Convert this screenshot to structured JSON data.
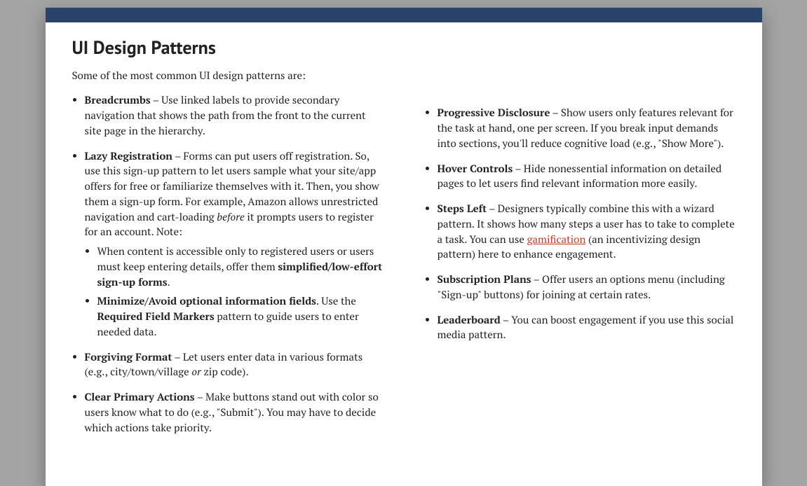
{
  "title": "UI Design Patterns",
  "intro": "Some of the most common UI design patterns are:",
  "col1": {
    "breadcrumbs": {
      "name": "Breadcrumbs",
      "desc": " – Use linked labels to provide secondary navigation that shows the path from the front to the current site page in the hierarchy."
    },
    "lazy": {
      "name": "Lazy Registration",
      "pre": " – Forms can put users off registration. So, use this sign-up pattern to let users sample what your site/app offers for free or familiarize themselves with it. Then, you show them a sign-up form. For example, Amazon allows unrestricted navigation and cart-loading ",
      "beforeWord": "before",
      "post": " it prompts users to register for an account. Note:",
      "sub1a": "When content is accessible only to registered users or users must keep entering details, offer them ",
      "sub1b": "simplified/low-effort sign-up forms",
      "sub1c": ".",
      "sub2a": "Minimize/Avoid optional information fields",
      "sub2b": ". Use the ",
      "sub2c": "Required Field Markers",
      "sub2d": " pattern to guide users to enter needed data."
    },
    "forgiving": {
      "name": "Forgiving Format",
      "pre": " – Let users enter data in various formats (e.g., city/town/village ",
      "orWord": "or",
      "post": " zip code)."
    },
    "clear": {
      "name": "Clear Primary Actions",
      "desc": " – Make buttons stand out with color so users know what to do (e.g., \"Submit\"). You may have to decide which actions take priority."
    }
  },
  "col2": {
    "progressive": {
      "name": "Progressive Disclosure",
      "desc": " – Show users only features relevant for the task at hand, one per screen. If you break input demands into sections, you'll reduce cognitive load (e.g., \"Show More\")."
    },
    "hover": {
      "name": "Hover Controls",
      "desc": " – Hide nonessential information on detailed pages to let users find relevant information more easily."
    },
    "steps": {
      "name": "Steps Left",
      "pre": " – Designers typically combine this with a wizard pattern. It shows how many steps a user has to take to complete a task. You can use ",
      "link": "gamification",
      "post": " (an incentivizing design pattern) here to enhance engagement."
    },
    "subscription": {
      "name": "Subscription Plans",
      "desc": " – Offer users an options menu (including \"Sign-up\" buttons) for joining at certain rates."
    },
    "leaderboard": {
      "name": "Leaderboard",
      "desc": " – You can boost engagement if you use this social media pattern."
    }
  }
}
